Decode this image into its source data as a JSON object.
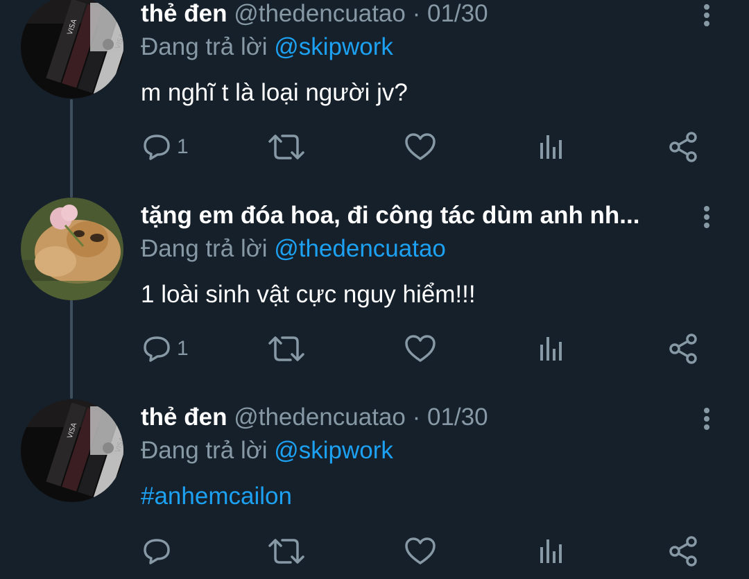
{
  "tweets": [
    {
      "display_name": "thẻ đen",
      "handle": "@thedencuatao",
      "separator": "·",
      "date": "01/30",
      "replying_prefix": "Đang trả lời",
      "replying_to": "@skipwork",
      "text": "m nghĩ t là loại người jv?",
      "reply_count": "1",
      "avatar": "black-cards-photo"
    },
    {
      "display_name": "tặng em đóa hoa, đi công tác dùm anh nh...",
      "replying_prefix": "Đang trả lời",
      "replying_to": "@thedencuatao",
      "text": "1 loài sinh vật cực nguy hiểm!!!",
      "reply_count": "1",
      "avatar": "puppy-with-flower-photo"
    },
    {
      "display_name": "thẻ đen",
      "handle": "@thedencuatao",
      "separator": "·",
      "date": "01/30",
      "replying_prefix": "Đang trả lời",
      "replying_to": "@skipwork",
      "text": "#anhemcailon",
      "reply_count": "",
      "avatar": "black-cards-photo"
    }
  ],
  "icons": {
    "reply": "speech-bubble-icon",
    "retweet": "retweet-arrows-icon",
    "like": "heart-outline-icon",
    "analytics": "bar-chart-icon",
    "share": "share-nodes-icon",
    "more": "vertical-dots-icon"
  },
  "colors": {
    "background": "#15202b",
    "text_primary": "#ffffff",
    "text_secondary": "#8899a6",
    "accent": "#1da1f2",
    "thread_line": "#3d4e5d"
  }
}
